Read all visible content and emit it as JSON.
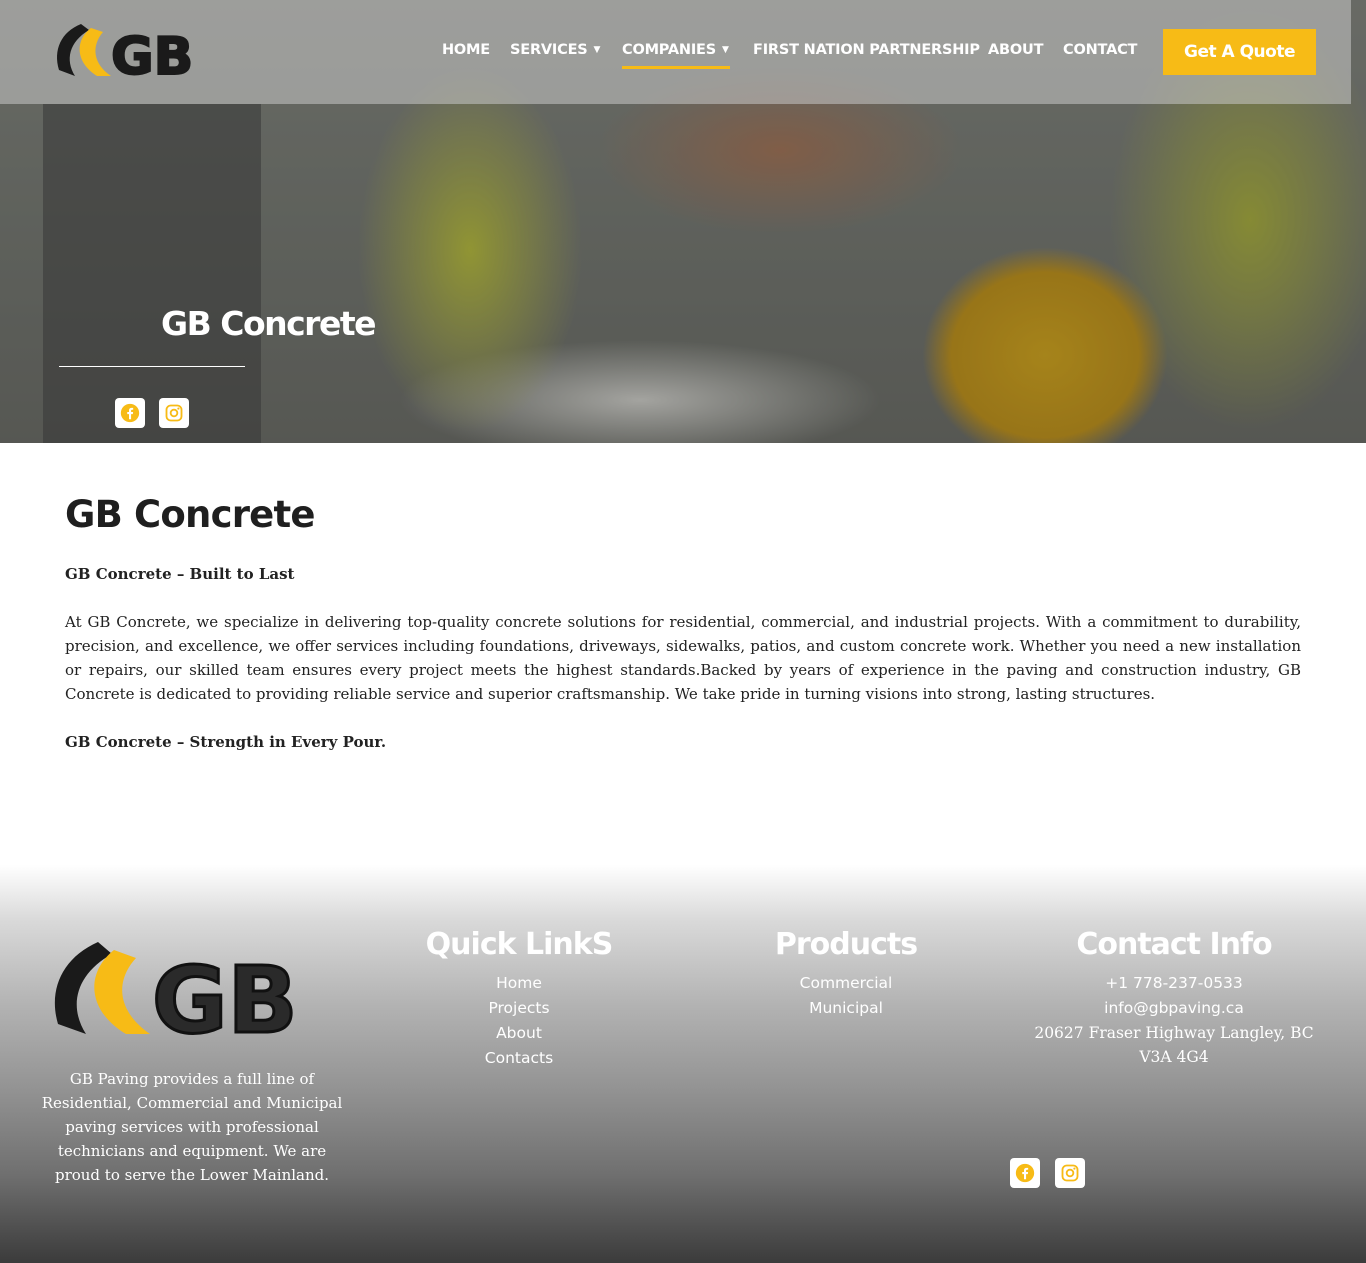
{
  "header": {
    "nav": [
      {
        "label": "HOME",
        "dropdown": false
      },
      {
        "label": "SERVICES",
        "dropdown": true
      },
      {
        "label": "COMPANIES",
        "dropdown": true,
        "active": true
      },
      {
        "label": "FIRST NATION PARTNERSHIP",
        "dropdown": false
      },
      {
        "label": "ABOUT",
        "dropdown": false
      },
      {
        "label": "CONTACT",
        "dropdown": false
      }
    ],
    "cta_label": "Get A Quote",
    "logo_text": "GB"
  },
  "hero": {
    "title": "GB Concrete",
    "social": [
      "facebook-icon",
      "instagram-icon"
    ]
  },
  "content": {
    "heading": "GB Concrete",
    "tagline": "GB Concrete – Built to Last",
    "paragraph": "At GB Concrete, we specialize in delivering top-quality concrete solutions for residential, commercial, and industrial projects. With a commitment to durability, precision, and excellence, we offer services including foundations, driveways, sidewalks, patios, and custom concrete work. Whether you need a new installation or repairs, our skilled team ensures every project meets the highest standards.Backed by years of experience in the paving and construction industry, GB Concrete is dedicated to providing reliable service and superior craftsmanship. We take pride in turning visions into strong, lasting structures.",
    "closing": "GB Concrete – Strength in Every Pour."
  },
  "footer": {
    "about": "GB Paving provides a full line of Residential, Commercial and Municipal paving services with professional technicians and equipment. We are proud to serve the Lower Mainland.",
    "quick_links": {
      "title": "Quick LinkS",
      "items": [
        "Home",
        "Projects",
        "About",
        "Contacts"
      ]
    },
    "products": {
      "title": "Products",
      "items": [
        "Commercial",
        "Municipal"
      ]
    },
    "contact": {
      "title": "Contact Info",
      "phone": "+1 778-237-0533",
      "email": "info@gbpaving.ca",
      "address": "20627 Fraser Highway Langley, BC V3A 4G4"
    },
    "social": [
      "facebook-icon",
      "instagram-icon"
    ]
  },
  "colors": {
    "accent": "#f7bb16",
    "dark": "#1f1f1f"
  }
}
